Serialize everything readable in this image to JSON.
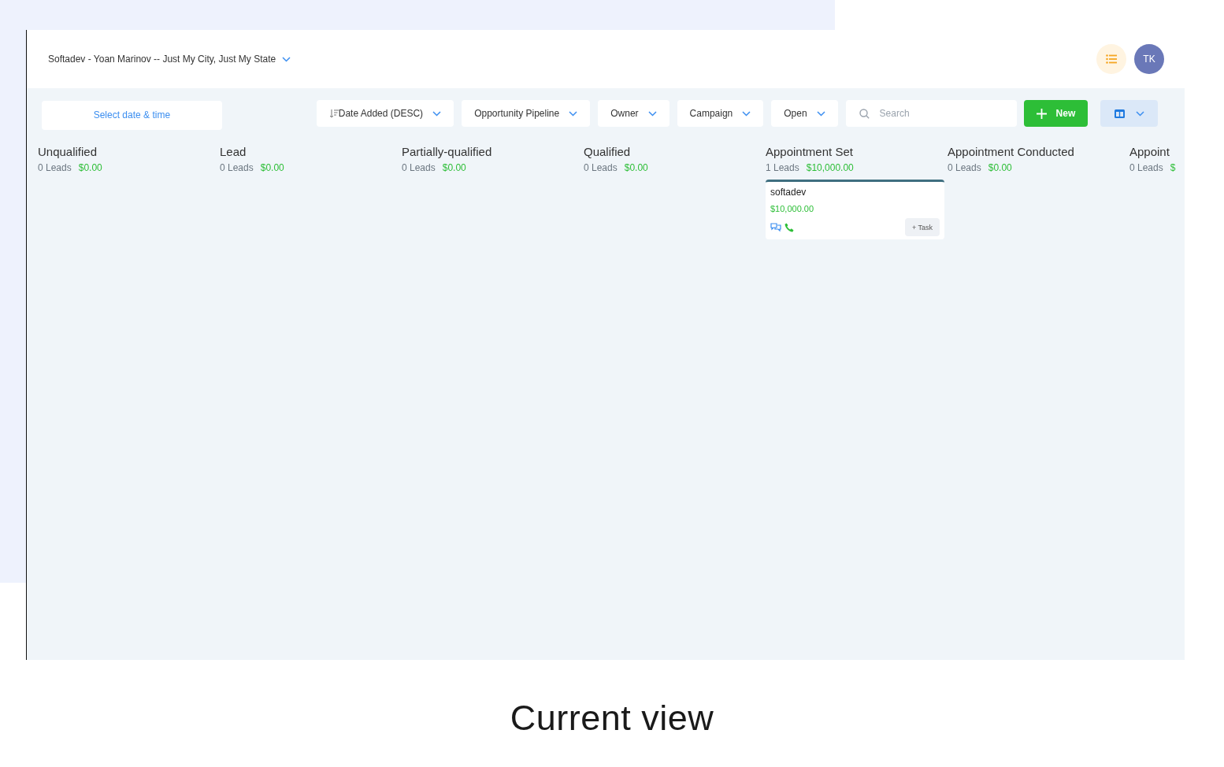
{
  "header": {
    "title": "Softadev - Yoan Marinov -- Just My City, Just My State",
    "avatar": "TK"
  },
  "toolbar": {
    "date_picker": "Select date & time",
    "filters": [
      {
        "label": "Date Added (DESC)",
        "kind": "sort"
      },
      {
        "label": "Opportunity Pipeline",
        "kind": "dropdown"
      },
      {
        "label": "Owner",
        "kind": "dropdown"
      },
      {
        "label": "Campaign",
        "kind": "dropdown"
      },
      {
        "label": "Open",
        "kind": "dropdown"
      }
    ],
    "search": {
      "placeholder": "Search"
    },
    "new_button": "New"
  },
  "columns": [
    {
      "title": "Unqualified",
      "count": "0 Leads",
      "amount": "$0.00"
    },
    {
      "title": "Lead",
      "count": "0 Leads",
      "amount": "$0.00"
    },
    {
      "title": "Partially-qualified",
      "count": "0 Leads",
      "amount": "$0.00"
    },
    {
      "title": "Qualified",
      "count": "0 Leads",
      "amount": "$0.00"
    },
    {
      "title": "Appointment Set",
      "count": "1 Leads",
      "amount": "$10,000.00",
      "cards": [
        {
          "name": "softadev",
          "amount": "$10,000.00",
          "task_button": "+ Task"
        }
      ]
    },
    {
      "title": "Appointment Conducted",
      "count": "0 Leads",
      "amount": "$0.00"
    },
    {
      "title": "Appoint",
      "count": "0 Leads",
      "amount": "$"
    }
  ],
  "caption": "Current view"
}
